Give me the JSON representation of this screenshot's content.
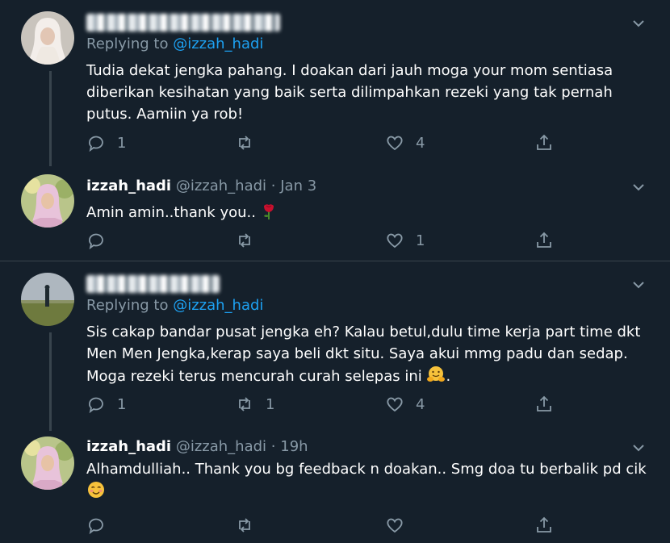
{
  "tweets": [
    {
      "name": "",
      "handle": "",
      "date": "",
      "replying_prefix": "Replying to",
      "replying_to": "@izzah_hadi",
      "text": "Tudia dekat jengka pahang. I doakan dari jauh moga your mom sentiasa diberikan kesihatan yang baik serta dilimpahkan rezeki yang tak pernah putus. Aamiin ya rob!",
      "reply_count": "1",
      "retweet_count": "",
      "like_count": "4"
    },
    {
      "name": "izzah_hadi",
      "handle": "@izzah_hadi",
      "dot": "·",
      "date": "Jan 3",
      "text": "Amin amin..thank you..",
      "emoji": "rose",
      "reply_count": "",
      "retweet_count": "",
      "like_count": "1"
    },
    {
      "name": "",
      "handle": "",
      "date": "",
      "replying_prefix": "Replying to",
      "replying_to": "@izzah_hadi",
      "text": "Sis cakap bandar pusat jengka eh? Kalau betul,dulu time kerja part time dkt Men Men Jengka,kerap saya beli dkt situ. Saya akui mmg padu dan sedap. Moga rezeki terus mencurah curah selepas ini",
      "emoji": "hugging-face",
      "text_end": ".",
      "reply_count": "1",
      "retweet_count": "1",
      "like_count": "4"
    },
    {
      "name": "izzah_hadi",
      "handle": "@izzah_hadi",
      "dot": "·",
      "date": "19h",
      "text": "Alhamdulliah.. Thank you bg feedback n doakan.. Smg doa tu berbalik pd cik",
      "emoji": "smiling-face",
      "reply_count": "",
      "retweet_count": "",
      "like_count": ""
    }
  ],
  "colors": {
    "background": "#15202b",
    "muted": "#8899a6",
    "link": "#1da1f2",
    "divider": "#38444d"
  },
  "icons": [
    "reply-icon",
    "retweet-icon",
    "like-icon",
    "share-icon",
    "chevron-down-icon"
  ]
}
